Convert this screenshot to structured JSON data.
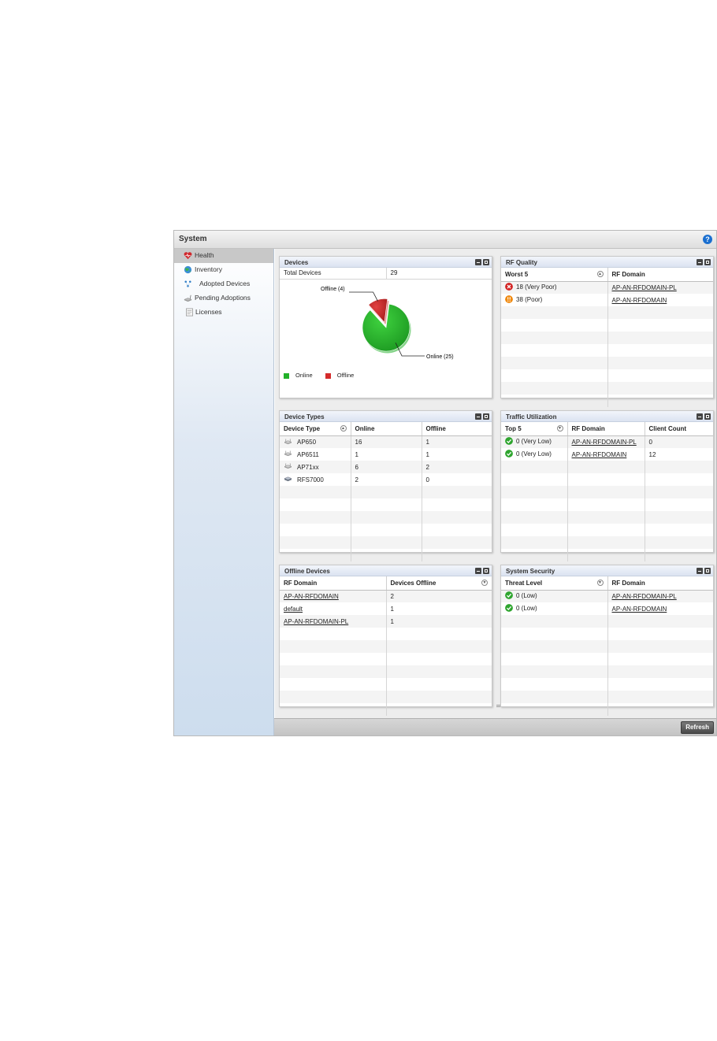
{
  "app": {
    "title": "System",
    "help_icon": "help-icon"
  },
  "sidebar": {
    "items": [
      {
        "label": "Health",
        "icon": "heart-icon",
        "active": true
      },
      {
        "label": "Inventory",
        "icon": "globe-icon"
      },
      {
        "label": "Adopted Devices",
        "icon": "network-icon"
      },
      {
        "label": "Pending Adoptions",
        "icon": "access-point-icon"
      },
      {
        "label": "Licenses",
        "icon": "document-icon"
      }
    ]
  },
  "devices": {
    "title": "Devices",
    "total_label": "Total Devices",
    "total_value": "29",
    "offline_label": "Offline (4)",
    "online_label": "Online (25)",
    "legend": [
      {
        "label": "Online",
        "color": "#22b12a"
      },
      {
        "label": "Offline",
        "color": "#d42b2b"
      }
    ]
  },
  "chart_data": {
    "type": "pie",
    "title": "",
    "slices": [
      {
        "label": "Online",
        "value": 25,
        "color": "#22b12a"
      },
      {
        "label": "Offline",
        "value": 4,
        "color": "#d42b2b"
      }
    ],
    "annotations": [
      "Offline (4)",
      "Online (25)"
    ],
    "legend": "bottom-left"
  },
  "rf_quality": {
    "title": "RF Quality",
    "headers": [
      "Worst 5",
      "RF Domain"
    ],
    "rows": [
      {
        "quality": "18 (Very Poor)",
        "domain": "AP-AN-RFDOMAIN-PL",
        "status": "very-poor"
      },
      {
        "quality": "38 (Poor)",
        "domain": "AP-AN-RFDOMAIN",
        "status": "poor"
      }
    ]
  },
  "device_types": {
    "title": "Device Types",
    "headers": [
      "Device Type",
      "Online",
      "Offline"
    ],
    "rows": [
      {
        "type": "AP650",
        "online": "16",
        "offline": "1"
      },
      {
        "type": "AP6511",
        "online": "1",
        "offline": "1"
      },
      {
        "type": "AP71xx",
        "online": "6",
        "offline": "2"
      },
      {
        "type": "RFS7000",
        "online": "2",
        "offline": "0"
      }
    ]
  },
  "traffic": {
    "title": "Traffic Utilization",
    "headers": [
      "Top 5",
      "RF Domain",
      "Client Count"
    ],
    "rows": [
      {
        "top": "0 (Very Low)",
        "domain": "AP-AN-RFDOMAIN-PL",
        "count": "0"
      },
      {
        "top": "0 (Very Low)",
        "domain": "AP-AN-RFDOMAIN",
        "count": "12"
      }
    ]
  },
  "offline_devices": {
    "title": "Offline Devices",
    "headers": [
      "RF Domain",
      "Devices Offline"
    ],
    "rows": [
      {
        "domain": "AP-AN-RFDOMAIN",
        "count": "2"
      },
      {
        "domain": "default",
        "count": "1"
      },
      {
        "domain": "AP-AN-RFDOMAIN-PL",
        "count": "1"
      }
    ]
  },
  "system_security": {
    "title": "System Security",
    "headers": [
      "Threat Level",
      "RF Domain"
    ],
    "rows": [
      {
        "level": "0 (Low)",
        "domain": "AP-AN-RFDOMAIN-PL"
      },
      {
        "level": "0 (Low)",
        "domain": "AP-AN-RFDOMAIN"
      }
    ]
  },
  "footer": {
    "refresh_label": "Refresh"
  }
}
